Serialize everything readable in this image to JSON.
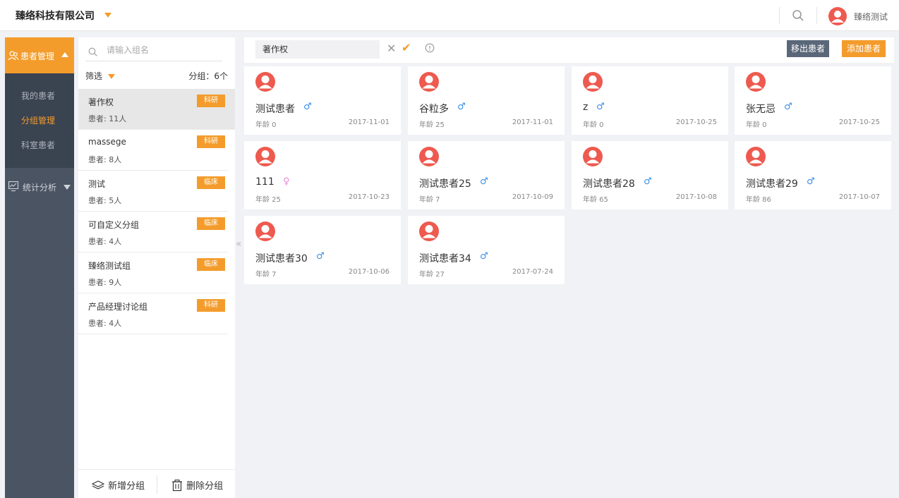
{
  "header": {
    "company": "臻络科技有限公司",
    "user_name": "臻络测试"
  },
  "sidebar": {
    "section": {
      "label": "患者管理"
    },
    "items": [
      {
        "label": "我的患者"
      },
      {
        "label": "分组管理",
        "active": true
      },
      {
        "label": "科室患者"
      }
    ],
    "stats": {
      "label": "统计分析"
    }
  },
  "groups": {
    "search_placeholder": "请输入组名",
    "filter_label": "筛选",
    "count_label": "分组：6个",
    "items": [
      {
        "name": "著作权",
        "count": "患者: 11人",
        "tag": "科研",
        "selected": true
      },
      {
        "name": "massege",
        "count": "患者: 8人",
        "tag": "科研"
      },
      {
        "name": "测试",
        "count": "患者: 5人",
        "tag": "临床"
      },
      {
        "name": "可自定义分组",
        "count": "患者: 4人",
        "tag": "临床"
      },
      {
        "name": "臻络测试组",
        "count": "患者: 9人",
        "tag": "临床"
      },
      {
        "name": "产品经理讨论组",
        "count": "患者: 4人",
        "tag": "科研"
      }
    ],
    "add_label": "新增分组",
    "delete_label": "删除分组",
    "collapse_icon": "«"
  },
  "toolbar": {
    "group_name_value": "著作权",
    "cancel_icon": "✕",
    "confirm_icon": "✔",
    "remove_label": "移出患者",
    "add_label": "添加患者"
  },
  "patients": [
    {
      "name": "测试患者",
      "gender": "male",
      "gender_symbol": "♂",
      "age": "年龄 0",
      "date": "2017-11-01"
    },
    {
      "name": "谷粒多",
      "gender": "male",
      "gender_symbol": "♂",
      "age": "年龄 25",
      "date": "2017-11-01"
    },
    {
      "name": "z",
      "gender": "male",
      "gender_symbol": "♂",
      "age": "年龄 0",
      "date": "2017-10-25"
    },
    {
      "name": "张无忌",
      "gender": "male",
      "gender_symbol": "♂",
      "age": "年龄 0",
      "date": "2017-10-25"
    },
    {
      "name": "111",
      "gender": "female",
      "gender_symbol": "♀",
      "age": "年龄 25",
      "date": "2017-10-23"
    },
    {
      "name": "测试患者25",
      "gender": "male",
      "gender_symbol": "♂",
      "age": "年龄 7",
      "date": "2017-10-09"
    },
    {
      "name": "测试患者28",
      "gender": "male",
      "gender_symbol": "♂",
      "age": "年龄 65",
      "date": "2017-10-08"
    },
    {
      "name": "测试患者29",
      "gender": "male",
      "gender_symbol": "♂",
      "age": "年龄 86",
      "date": "2017-10-07"
    },
    {
      "name": "测试患者30",
      "gender": "male",
      "gender_symbol": "♂",
      "age": "年龄 7",
      "date": "2017-10-06"
    },
    {
      "name": "测试患者34",
      "gender": "male",
      "gender_symbol": "♂",
      "age": "年龄 27",
      "date": "2017-07-24"
    }
  ],
  "colors": {
    "accent": "#f39c2c",
    "sidebar": "#4a5463",
    "male": "#3a8ee6",
    "female": "#e889d6",
    "avatar": "#ee5a4f"
  }
}
